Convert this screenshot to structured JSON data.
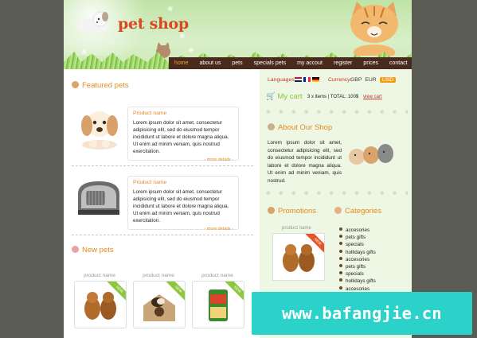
{
  "header": {
    "logo_text": "pet shop"
  },
  "nav": {
    "items": [
      {
        "label": "home",
        "active": true
      },
      {
        "label": "about us",
        "active": false
      },
      {
        "label": "pets",
        "active": false
      },
      {
        "label": "specials pets",
        "active": false
      },
      {
        "label": "my accout",
        "active": false
      },
      {
        "label": "register",
        "active": false
      },
      {
        "label": "prices",
        "active": false
      },
      {
        "label": "contact",
        "active": false
      }
    ]
  },
  "featured": {
    "title": "Featured pets",
    "items": [
      {
        "name": "Product name",
        "desc": "Lorem ipsum dolor sit amet, consectetur adipisicing elit, sed do eiusmod tempor incididunt ut labore et dolore magna aliqua. Ut enim ad minim veniam, quis nostrud exercitation.",
        "more": "- more details -",
        "icon": "puppy-image"
      },
      {
        "name": "Product name",
        "desc": "Lorem ipsum dolor sit amet, consectetur adipisicing elit, sed do eiusmod tempor incididunt ut labore et dolore magna aliqua. Ut enim ad minim veniam, quis nostrud exercitation.",
        "more": "- more details -",
        "icon": "pet-carrier-image"
      }
    ]
  },
  "new_pets": {
    "title": "New pets",
    "items": [
      {
        "name": "product name",
        "badge": "NEW"
      },
      {
        "name": "product name",
        "badge": "NEW"
      },
      {
        "name": "product name",
        "badge": "NEW"
      }
    ]
  },
  "sidebar": {
    "languages_label": "Languages:",
    "currency_label": "Currency:",
    "currencies": [
      "GBP",
      "EUR",
      "USD"
    ],
    "cart_title": "My cart",
    "cart_info": "3 x items | TOTAL: 100$",
    "view_cart": "view cart",
    "about_title": "About Our Shop",
    "about_text": "Lorem ipsum dolor sit amet, consectetur adipisicing elit, sed do eiusmod tempor incididunt ut labore et dolore magna aliqua. Ut enim ad minim veniam, quis nostrud.",
    "promotions_title": "Promotions",
    "promo_product": "product name",
    "promo_badge": "NEW",
    "categories_title": "Categories",
    "categories": [
      "accesories",
      "pets gifts",
      "specials",
      "hollidays gifts",
      "accesories",
      "pets gifts",
      "specials",
      "hollidays gifts",
      "accesories"
    ]
  },
  "watermark": "www.bafangjie.cn",
  "colors": {
    "accent": "#e68a1a",
    "nav_bg": "#4a2a1c",
    "sidebar_bg": "#eef6e4",
    "cart_green": "#8dc63f",
    "watermark_bg": "#2ad2c9"
  }
}
